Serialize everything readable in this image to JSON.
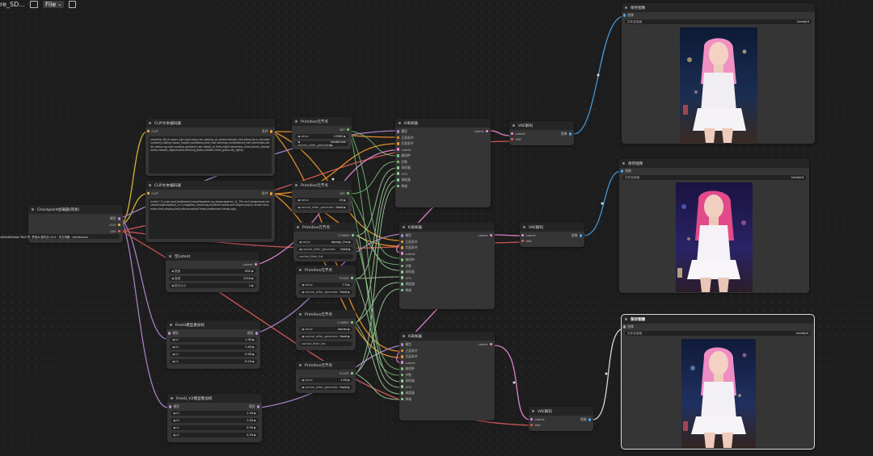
{
  "topbar": {
    "title": "re_SD...",
    "file_label": "File"
  },
  "colors": {
    "model": "#b48ad6",
    "clip": "#e7c23b",
    "vae": "#e25c5c",
    "conditioning": "#f39a2e",
    "latent": "#f08ddf",
    "image": "#4aa3e8",
    "int": "#7cc77a"
  },
  "checkpoint": {
    "title": "Checkpoint加载器(简易)",
    "out_model": "模型",
    "out_clip": "CLIP",
    "out_vae": "VAE",
    "ckpt_label": "Checkpoint名称",
    "ckpt_value": "ubliteit\\Dream Tech 🔍 梦羽AI 超写实 v5.0 - 东方风格 · safetensors"
  },
  "clip1": {
    "title": "CLIP文本编码器",
    "in": "CLIP",
    "out": "条件",
    "text": "sensitive,1B-cit-years,1girl,solo,long_hair,looking_at_viewer,blonde_hair,dress,bare_shoulders,jewelry,sitting,closed_mouth,collarbone,pink_hair,earrings,multicolored_hair,sleeveless,white_dress,cup,sign,makeup,gradient_hair,depth_of_field,night,sleeveless_dress,blurry_background,crossed_legs,alcohol,drinking_glass,realistic,wine_glass,city_lights,"
  },
  "clip2": {
    "title": "CLIP文本编码器",
    "in": "CLIP",
    "out": "条件",
    "text": "(nsfw:1.3),(sign,text,badhandv4,easyNegative,ng_deepnegative_v1_75t,rev2-badprompt,verybadimagenegative_v1.3,negative_hand-neg,mutated hands and fingers,poorly drawn face,extra limb,missing limb,disconnected limbs,malformed hands,ugly,"
  },
  "latent": {
    "title": "空Latent",
    "out": "Latent",
    "w_label": "宽度",
    "w_val": "832",
    "h_label": "高度",
    "h_val": "1216",
    "b_label": "批次大小",
    "b_val": "1"
  },
  "freeu1": {
    "title": "FreeU模型重加权",
    "in": "模型",
    "out": "模型",
    "rows": [
      {
        "k": "b1",
        "v": "1.30"
      },
      {
        "k": "b2",
        "v": "1.40"
      },
      {
        "k": "s1",
        "v": "0.90"
      },
      {
        "k": "s2",
        "v": "0.20"
      }
    ]
  },
  "freeu2": {
    "title": "FreeU_V2模型重加权",
    "in": "模型",
    "out": "模型",
    "rows": [
      {
        "k": "b1",
        "v": "1.30"
      },
      {
        "k": "b2",
        "v": "1.40"
      },
      {
        "k": "s1",
        "v": "0.90"
      },
      {
        "k": "s2",
        "v": "0.20"
      }
    ]
  },
  "prim1": {
    "title": "Primitive元节点",
    "out": "INT",
    "value_label": "value",
    "value": "12382",
    "ctrl_label": "control_after_generate",
    "ctrl_value": "randomize"
  },
  "prim2": {
    "title": "Primitive元节点",
    "out": "INT",
    "value_label": "value",
    "value": "25",
    "ctrl_label": "control_after_generate",
    "ctrl_value": "fixed"
  },
  "prim3": {
    "title": "Primitive元节点",
    "out": "COMBO",
    "value_label": "value",
    "value": "dpmpp_2m",
    "ctrl_label": "control_after_generate",
    "ctrl_value": "fixed",
    "filter_label": "control_filter_list"
  },
  "prim4": {
    "title": "Primitive元节点",
    "out": "FLOAT",
    "value_label": "value",
    "value": "7.5",
    "ctrl_label": "control_after_generate",
    "ctrl_value": "fixed"
  },
  "prim5": {
    "title": "Primitive元节点",
    "out": "COMBO",
    "value_label": "value",
    "value": "karras",
    "ctrl_label": "control_after_generate",
    "ctrl_value": "fixed",
    "filter_label": "control_filter_list"
  },
  "prim6": {
    "title": "Primitive元节点",
    "out": "FLOAT",
    "value_label": "value",
    "value": "1.00",
    "ctrl_label": "control_after_generate",
    "ctrl_value": "fixed"
  },
  "ksampler": {
    "title": "K采样器",
    "out": "Latent",
    "inputs": [
      "模型",
      "正面条件",
      "负面条件",
      "Latent",
      "随机种",
      "步数",
      "采样器",
      "CFG",
      "调度器",
      "降噪"
    ]
  },
  "vae": {
    "title": "VAE解码",
    "in_latent": "Latent",
    "in_vae": "VAE",
    "out": "图像"
  },
  "save": {
    "title": "保存图像",
    "in": "图像",
    "prefix_label": "文件名前缀",
    "prefix_value": "ComfyUI"
  }
}
